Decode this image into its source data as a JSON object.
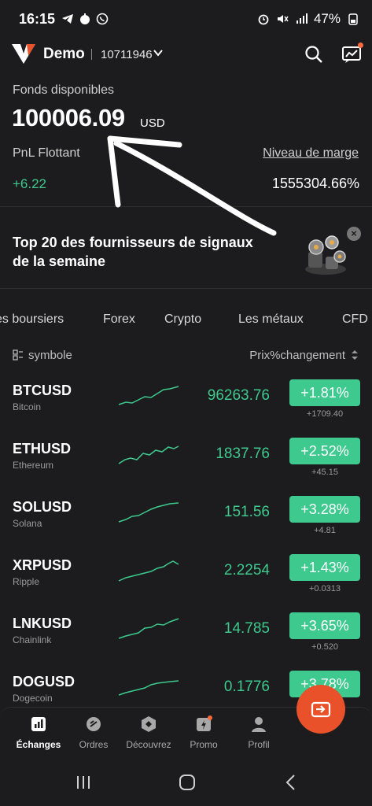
{
  "status_bar": {
    "time": "16:15",
    "battery": "47%",
    "network": "4G+"
  },
  "header": {
    "account_type": "Demo",
    "account_id": "10711946"
  },
  "summary": {
    "funds_label": "Fonds disponibles",
    "funds_value": "100006.09",
    "funds_currency": "USD",
    "pnl_label": "PnL Flottant",
    "pnl_value": "+6.22",
    "margin_label": "Niveau de marge",
    "margin_value": "1555304.66%"
  },
  "promo": {
    "text": "Top 20 des fournisseurs de signaux de la semaine"
  },
  "tabs": [
    "es boursiers",
    "Forex",
    "Crypto",
    "Les métaux",
    "CFD"
  ],
  "list_header": {
    "symbol_label": "symbole",
    "price_label": "Prix%changement"
  },
  "instruments": [
    {
      "symbol": "BTCUSD",
      "name": "Bitcoin",
      "price": "96263.76",
      "change_pct": "+1.81%",
      "change_abs": "+1709.40"
    },
    {
      "symbol": "ETHUSD",
      "name": "Ethereum",
      "price": "1837.76",
      "change_pct": "+2.52%",
      "change_abs": "+45.15"
    },
    {
      "symbol": "SOLUSD",
      "name": "Solana",
      "price": "151.56",
      "change_pct": "+3.28%",
      "change_abs": "+4.81"
    },
    {
      "symbol": "XRPUSD",
      "name": "Ripple",
      "price": "2.2254",
      "change_pct": "+1.43%",
      "change_abs": "+0.0313"
    },
    {
      "symbol": "LNKUSD",
      "name": "Chainlink",
      "price": "14.785",
      "change_pct": "+3.65%",
      "change_abs": "+0.520"
    },
    {
      "symbol": "DOGUSD",
      "name": "Dogecoin",
      "price": "0.1776",
      "change_pct": "+3.78%",
      "change_abs": ""
    }
  ],
  "bottom_nav": [
    "Échanges",
    "Ordres",
    "Découvrez",
    "Promo",
    "Profil"
  ],
  "colors": {
    "accent_green": "#3ec98e",
    "brand_orange": "#e8512a",
    "background": "#1c1c1e"
  }
}
